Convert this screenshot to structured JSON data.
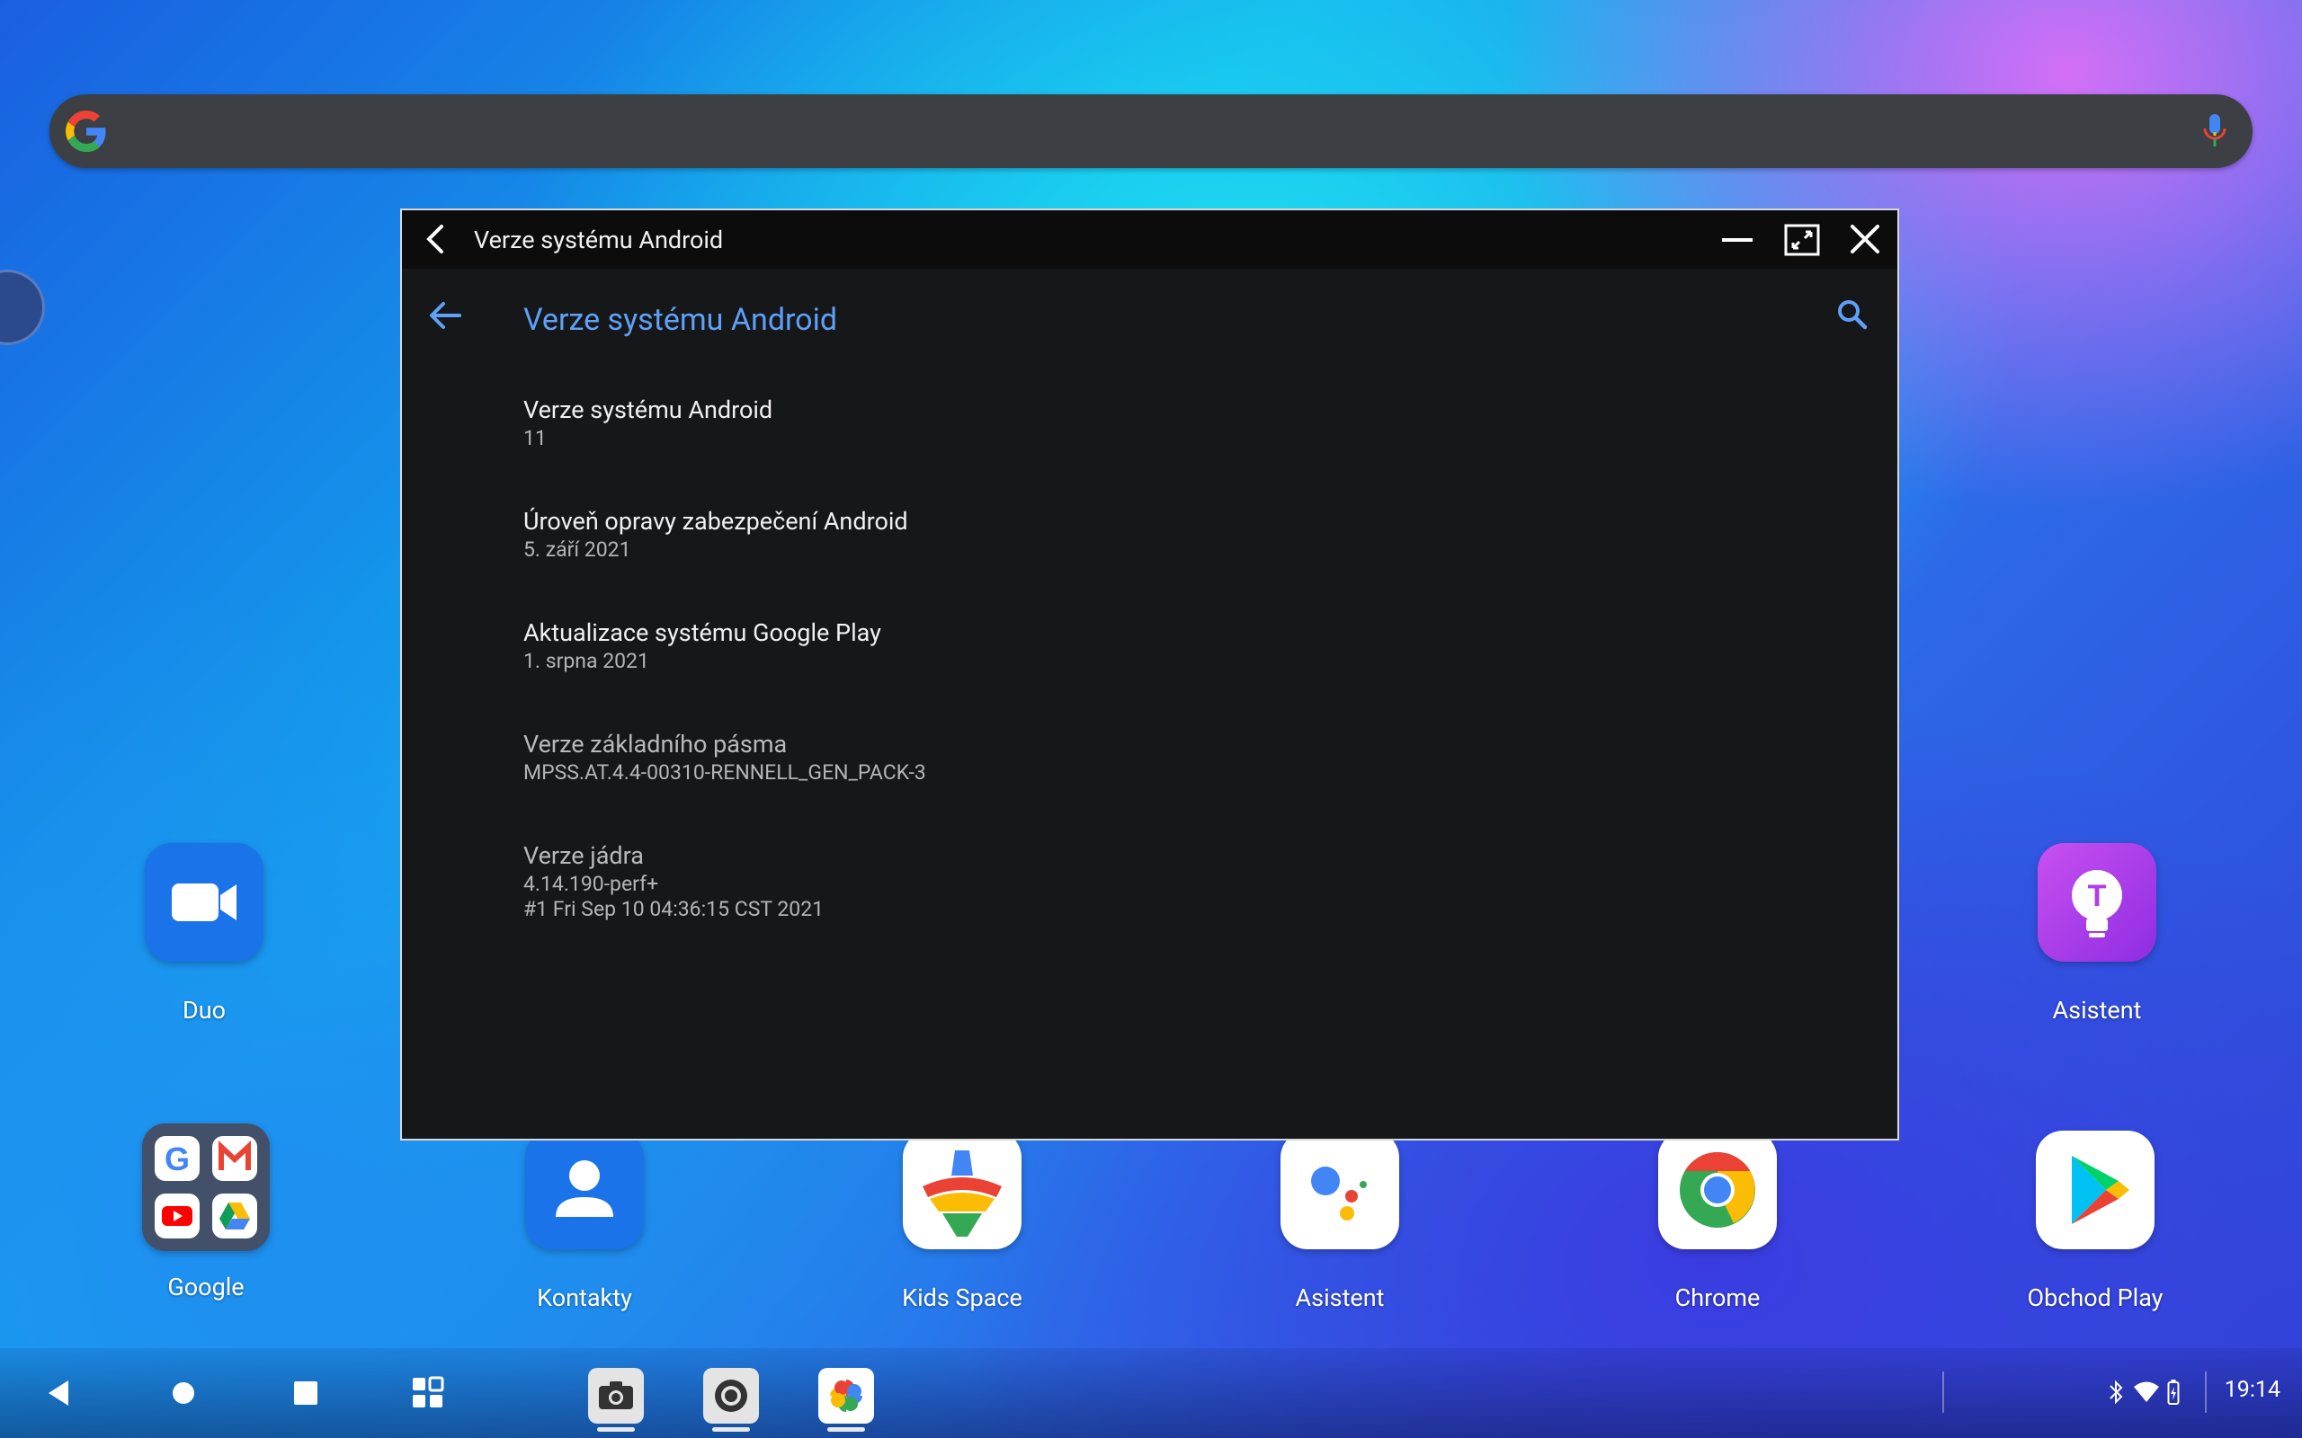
{
  "search": {
    "placeholder": ""
  },
  "window": {
    "titlebar_title": "Verze systému Android",
    "header_title": "Verze systému Android",
    "items": [
      {
        "title": "Verze systému Android",
        "values": [
          "11"
        ]
      },
      {
        "title": "Úroveň opravy zabezpečení Android",
        "values": [
          "5. září 2021"
        ]
      },
      {
        "title": "Aktualizace systému Google Play",
        "values": [
          "1. srpna 2021"
        ]
      },
      {
        "title": "Verze základního pásma",
        "values": [
          "MPSS.AT.4.4-00310-RENNELL_GEN_PACK-3"
        ]
      },
      {
        "title": "Verze jádra",
        "values": [
          "4.14.190-perf+",
          "#1 Fri Sep 10 04:36:15 CST 2021"
        ]
      }
    ]
  },
  "home_apps": {
    "duo": "Duo",
    "asistent_top": "Asistent",
    "google_folder": "Google",
    "kontakty": "Kontakty",
    "kids_space": "Kids Space",
    "asistent": "Asistent",
    "chrome": "Chrome",
    "obchod_play": "Obchod Play"
  },
  "status": {
    "time": "19:14"
  },
  "colors": {
    "accent": "#5fa0f8",
    "window_bg": "#161719",
    "titlebar_bg": "#0c0c0d",
    "searchbar_bg": "#3c3f44"
  }
}
